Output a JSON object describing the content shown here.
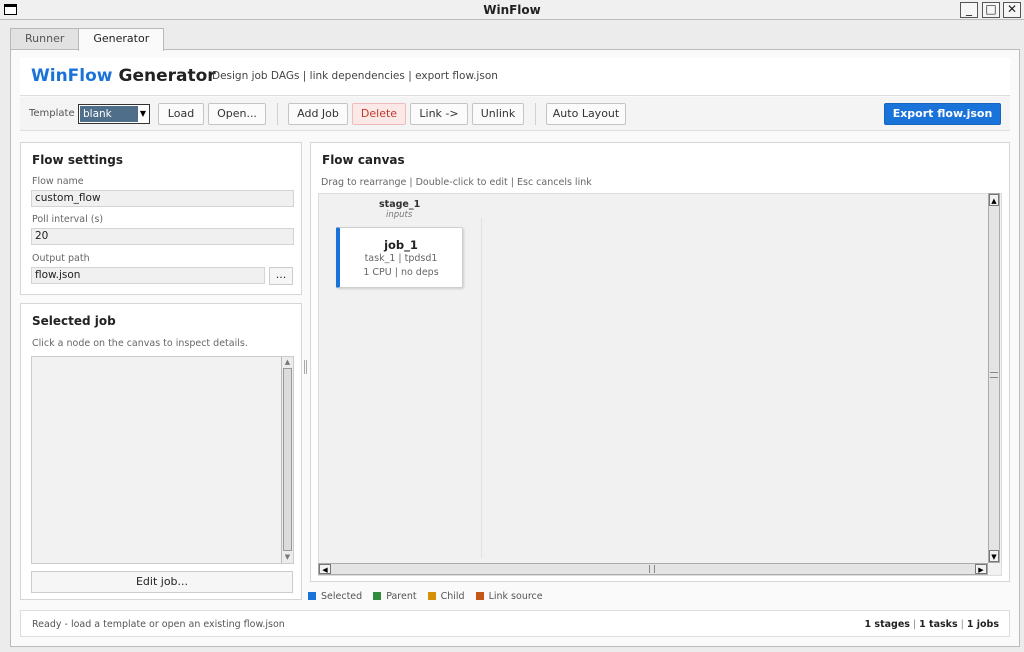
{
  "window": {
    "title": "WinFlow"
  },
  "tabs": [
    {
      "label": "Runner"
    },
    {
      "label": "Generator"
    }
  ],
  "header": {
    "brand": "WinFlow",
    "brand_suffix": "Generator",
    "subtitle": "Design job DAGs | link dependencies | export flow.json"
  },
  "toolbar": {
    "template_label": "Template",
    "template_value": "blank",
    "load": "Load",
    "open": "Open...",
    "add_job": "Add Job",
    "delete": "Delete",
    "link": "Link ->",
    "unlink": "Unlink",
    "auto_layout": "Auto Layout",
    "export": "Export flow.json"
  },
  "flow_settings": {
    "title": "Flow settings",
    "flow_name_label": "Flow name",
    "flow_name": "custom_flow",
    "poll_label": "Poll interval (s)",
    "poll": "20",
    "output_label": "Output path",
    "output": "flow.json",
    "browse": "..."
  },
  "selected_job": {
    "title": "Selected job",
    "hint": "Click a node on the canvas to inspect details.",
    "edit": "Edit job..."
  },
  "canvas": {
    "title": "Flow canvas",
    "hint": "Drag to rearrange | Double-click to edit | Esc cancels link",
    "stages": [
      {
        "name": "stage_1",
        "sub": "inputs"
      }
    ],
    "nodes": [
      {
        "title": "job_1",
        "sub": "task_1 | tpdsd1",
        "detail": "1 CPU  |  no deps"
      }
    ]
  },
  "legend": [
    {
      "label": "Selected",
      "color": "#1a73d9"
    },
    {
      "label": "Parent",
      "color": "#2e8b3d"
    },
    {
      "label": "Child",
      "color": "#d4920a"
    },
    {
      "label": "Link source",
      "color": "#c4561a"
    }
  ],
  "status": {
    "text": "Ready - load a template or open an existing flow.json",
    "stages": "1 stages",
    "tasks": "1 tasks",
    "jobs": "1 jobs"
  }
}
